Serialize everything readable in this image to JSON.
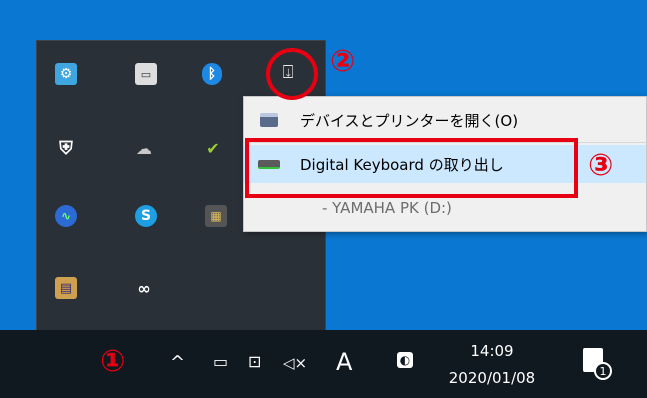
{
  "tray_flyout": {
    "icons": [
      "control-panel-icon",
      "monitor-icon",
      "bluetooth-icon",
      "usb-eject-icon",
      "security-warning-icon",
      "cloud-offline-icon",
      "checkmark-drive-icon",
      "vpn-icon",
      "skype-icon",
      "app-icon",
      "printer-icon",
      "link-icon"
    ]
  },
  "context_menu": {
    "open_devices": "デバイスとプリンターを開く(O)",
    "eject_device": "Digital Keyboard の取り出し",
    "drive_entry": "- YAMAHA PK (D:)"
  },
  "annotations": {
    "step1": "①",
    "step2": "②",
    "step3": "③",
    "color": "#e60012"
  },
  "taskbar": {
    "chevron": "^",
    "ime_mode": "A",
    "time": "14:09",
    "date": "2020/01/08",
    "notification_count": "1"
  }
}
